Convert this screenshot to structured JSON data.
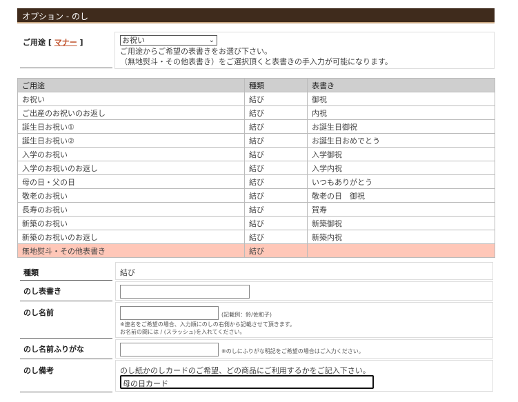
{
  "header": {
    "title": "オプション - のし"
  },
  "usage": {
    "label_prefix": "ご用途 [",
    "manner_link": "マナー",
    "label_suffix": "]",
    "selected": "お祝い",
    "note1": "ご用途からご希望の表書きをお選び下さい。",
    "note2": "（無地熨斗・その他表書き）をご選択頂くと表書きの手入力が可能になります。"
  },
  "table": {
    "headers": [
      "ご用途",
      "種類",
      "表書き"
    ],
    "rows": [
      [
        "お祝い",
        "結び",
        "御祝"
      ],
      [
        "ご出産のお祝いのお返し",
        "結び",
        "内祝"
      ],
      [
        "誕生日お祝い①",
        "結び",
        "お誕生日御祝"
      ],
      [
        "誕生日お祝い②",
        "結び",
        "お誕生日おめでとう"
      ],
      [
        "入学のお祝い",
        "結び",
        "入学御祝"
      ],
      [
        "入学のお祝いのお返し",
        "結び",
        "入学内祝"
      ],
      [
        "母の日・父の日",
        "結び",
        "いつもありがとう"
      ],
      [
        "敬老のお祝い",
        "結び",
        "敬老の日　御祝"
      ],
      [
        "長寿のお祝い",
        "結び",
        "賀寿"
      ],
      [
        "新築のお祝い",
        "結び",
        "新築御祝"
      ],
      [
        "新築のお祝いのお返し",
        "結び",
        "新築内祝"
      ],
      [
        "無地熨斗・その他表書き",
        "結び",
        ""
      ]
    ],
    "selected_index": 11
  },
  "form": {
    "type_label": "種類",
    "type_value": "結び",
    "omote_label": "のし表書き",
    "omote_value": "",
    "name_label": "のし名前",
    "name_value": "",
    "name_example": "(記載例：鈴/佐和子)",
    "name_help1": "※連名をご希望の場合、入力順にのしの右側から記載させて頂きます。",
    "name_help2": "お名前の間には / (スラッシュ)を入れてください。",
    "furigana_label": "のし名前ふりがな",
    "furigana_value": "",
    "furigana_help": "※のしにふりがな明記をご希望の場合はご入力ください。",
    "biko_label": "のし備考",
    "biko_help": "のし紙かのしカードのご希望、どの商品にご利用するかをご記入下さい。",
    "biko_value": "母の日カード"
  }
}
